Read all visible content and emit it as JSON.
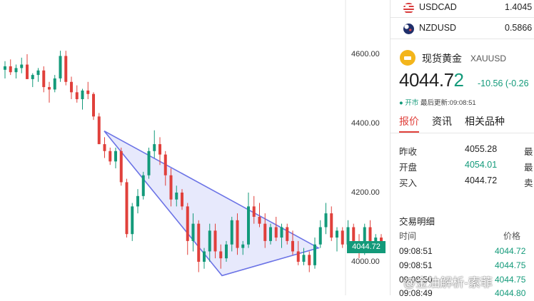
{
  "chart_data": {
    "type": "candlestick",
    "y_ticks": [
      4600,
      4400,
      4200,
      4000
    ],
    "y_tick_labels": [
      "4600.00",
      "4400.00",
      "4200.00",
      "4000.00"
    ],
    "current_price": "4044.72",
    "colors": {
      "up": "#139a7a",
      "down": "#e0403b",
      "triangle": "#6b73e6",
      "triangle_fill": "#dfe2fb"
    },
    "pattern": "symmetrical-triangle",
    "candles": [
      [
        4555,
        4580,
        4530,
        4565
      ],
      [
        4565,
        4585,
        4540,
        4548
      ],
      [
        4548,
        4570,
        4530,
        4560
      ],
      [
        4560,
        4590,
        4545,
        4570
      ],
      [
        4570,
        4600,
        4550,
        4528
      ],
      [
        4528,
        4545,
        4505,
        4540
      ],
      [
        4540,
        4560,
        4520,
        4553
      ],
      [
        4553,
        4565,
        4490,
        4505
      ],
      [
        4505,
        4520,
        4460,
        4498
      ],
      [
        4498,
        4540,
        4490,
        4530
      ],
      [
        4530,
        4610,
        4520,
        4595
      ],
      [
        4595,
        4610,
        4510,
        4520
      ],
      [
        4520,
        4535,
        4470,
        4490
      ],
      [
        4490,
        4510,
        4460,
        4470
      ],
      [
        4470,
        4500,
        4440,
        4495
      ],
      [
        4495,
        4520,
        4470,
        4485
      ],
      [
        4485,
        4490,
        4410,
        4420
      ],
      [
        4420,
        4430,
        4340,
        4340
      ],
      [
        4340,
        4360,
        4300,
        4320
      ],
      [
        4320,
        4330,
        4280,
        4290
      ],
      [
        4290,
        4330,
        4270,
        4320
      ],
      [
        4320,
        4330,
        4220,
        4230
      ],
      [
        4230,
        4240,
        4070,
        4080
      ],
      [
        4080,
        4170,
        4060,
        4160
      ],
      [
        4160,
        4210,
        4140,
        4190
      ],
      [
        4190,
        4260,
        4180,
        4250
      ],
      [
        4250,
        4330,
        4240,
        4320
      ],
      [
        4320,
        4380,
        4300,
        4340
      ],
      [
        4340,
        4360,
        4280,
        4310
      ],
      [
        4310,
        4320,
        4220,
        4250
      ],
      [
        4250,
        4270,
        4160,
        4180
      ],
      [
        4180,
        4220,
        4160,
        4200
      ],
      [
        4200,
        4210,
        4150,
        4160
      ],
      [
        4160,
        4170,
        4020,
        4060
      ],
      [
        4060,
        4140,
        4030,
        4110
      ],
      [
        4110,
        4120,
        3970,
        4000
      ],
      [
        4000,
        4040,
        3980,
        4030
      ],
      [
        4030,
        4110,
        4000,
        4090
      ],
      [
        4090,
        4110,
        4010,
        4030
      ],
      [
        4030,
        4050,
        3980,
        4010
      ],
      [
        4010,
        4060,
        4000,
        4050
      ],
      [
        4050,
        4130,
        4030,
        4120
      ],
      [
        4120,
        4140,
        4020,
        4040
      ],
      [
        4040,
        4060,
        4020,
        4050
      ],
      [
        4050,
        4200,
        4040,
        4160
      ],
      [
        4160,
        4190,
        4110,
        4130
      ],
      [
        4130,
        4170,
        4100,
        4110
      ],
      [
        4110,
        4140,
        4040,
        4060
      ],
      [
        4060,
        4110,
        4050,
        4100
      ],
      [
        4100,
        4130,
        4060,
        4070
      ],
      [
        4070,
        4110,
        4040,
        4100
      ],
      [
        4100,
        4110,
        4050,
        4060
      ],
      [
        4060,
        4090,
        4020,
        4030
      ],
      [
        4030,
        4060,
        3990,
        4000
      ],
      [
        4000,
        4040,
        3990,
        4020
      ],
      [
        4020,
        4030,
        3970,
        3990
      ],
      [
        3990,
        4070,
        3980,
        4050
      ],
      [
        4050,
        4120,
        4040,
        4100
      ],
      [
        4100,
        4170,
        4080,
        4140
      ],
      [
        4140,
        4160,
        4060,
        4070
      ],
      [
        4070,
        4100,
        4030,
        4090
      ],
      [
        4090,
        4100,
        4040,
        4050
      ],
      [
        4050,
        4120,
        4040,
        4100
      ],
      [
        4100,
        4110,
        4050,
        4060
      ],
      [
        4060,
        4080,
        4010,
        4030
      ],
      [
        4030,
        4110,
        4020,
        4100
      ],
      [
        4100,
        4120,
        4040,
        4050
      ],
      [
        4050,
        4080,
        4030,
        4070
      ],
      [
        4070,
        4080,
        4030,
        4045
      ]
    ]
  },
  "tickers": [
    {
      "flag": "us-flag",
      "symbol": "USDCAD",
      "value": "1.4045",
      "sup": "3"
    },
    {
      "flag": "nz-flag",
      "symbol": "NZDUSD",
      "value": "0.5866",
      "sup": "3"
    }
  ],
  "instrument": {
    "icon": "gold-bar-icon",
    "name": "现货黄金",
    "code": "XAUUSD",
    "price_main": "4044.7",
    "price_last": "2",
    "change": "-10.56 (-0.26",
    "status": "● 开市",
    "updated_label": "最后更新:",
    "updated_time": "09:08:51"
  },
  "tabs": [
    "报价",
    "资讯",
    "相关品种"
  ],
  "quote_rows": [
    {
      "label": "昨收",
      "value": "4055.28",
      "color": "#222222",
      "trail": "最"
    },
    {
      "label": "开盘",
      "value": "4054.01",
      "color": "#139a7a",
      "trail": "最"
    },
    {
      "label": "买入",
      "value": "4044.72",
      "color": "#222222",
      "trail": "卖"
    }
  ],
  "trades": {
    "title": "交易明细",
    "col_time": "时间",
    "col_price": "价格",
    "rows": [
      {
        "time": "09:08:51",
        "price": "4044.72"
      },
      {
        "time": "09:08:51",
        "price": "4044.75"
      },
      {
        "time": "09:08:50",
        "price": "4044.75"
      },
      {
        "time": "09:08:49",
        "price": "4044.80"
      }
    ]
  },
  "watermark": "@金油解析-索菲"
}
